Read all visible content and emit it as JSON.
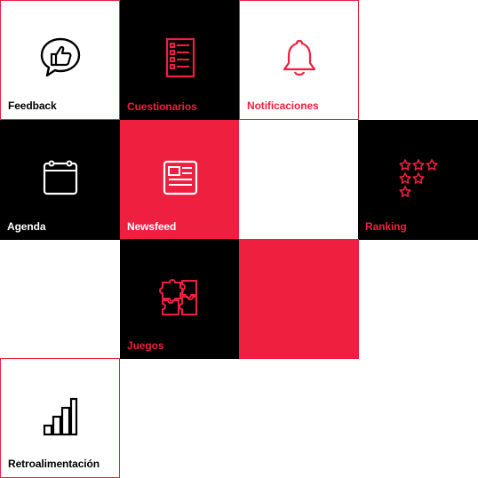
{
  "colors": {
    "accent": "#ef1f3f",
    "dark": "#000000",
    "light": "#ffffff"
  },
  "tiles": {
    "feedback": {
      "label": "Feedback",
      "icon": "thumbs-up-chat-icon"
    },
    "cuestionarios": {
      "label": "Cuestionarios",
      "icon": "checklist-icon"
    },
    "notificaciones": {
      "label": "Notificaciones",
      "icon": "bell-icon"
    },
    "agenda": {
      "label": "Agenda",
      "icon": "calendar-icon"
    },
    "newsfeed": {
      "label": "Newsfeed",
      "icon": "newspaper-icon"
    },
    "ranking": {
      "label": "Ranking",
      "icon": "stars-icon"
    },
    "juegos": {
      "label": "Juegos",
      "icon": "puzzle-icon"
    },
    "retroalimentacion": {
      "label": "Retroalimentación",
      "icon": "bar-chart-icon"
    }
  }
}
